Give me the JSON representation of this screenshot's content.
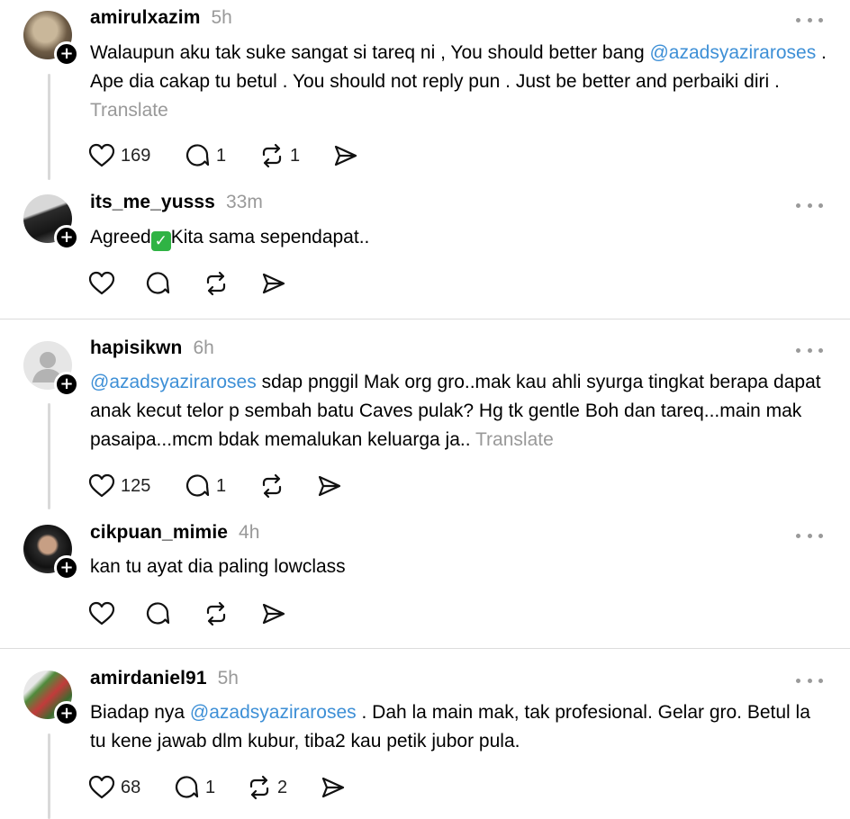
{
  "posts": [
    {
      "username": "amirulxazim",
      "time": "5h",
      "text_parts": [
        "Walaupun aku tak suke sangat si tareq ni , You should better bang ",
        "@azadsyaziraroses",
        " . Ape dia cakap tu betul . You should not reply pun . Just be better and perbaiki diri . ",
        "Translate"
      ],
      "likes": "169",
      "replies": "1",
      "reposts": "1"
    },
    {
      "username": "its_me_yusss",
      "time": "33m",
      "text_parts": [
        "Agreed",
        "✓",
        "Kita sama sependapat.."
      ],
      "likes": "",
      "replies": "",
      "reposts": ""
    },
    {
      "username": "hapisikwn",
      "time": "6h",
      "text_parts": [
        "@azadsyaziraroses",
        " sdap pnggil Mak org gro..mak kau ahli syurga tingkat berapa dapat anak kecut telor p sembah batu Caves pulak? Hg tk gentle Boh dan tareq...main mak pasaipa...mcm bdak memalukan keluarga ja.. ",
        "Translate"
      ],
      "likes": "125",
      "replies": "1",
      "reposts": ""
    },
    {
      "username": "cikpuan_mimie",
      "time": "4h",
      "text_parts": [
        "kan tu ayat dia paling lowclass"
      ],
      "likes": "",
      "replies": "",
      "reposts": ""
    },
    {
      "username": "amirdaniel91",
      "time": "5h",
      "text_parts": [
        "Biadap nya ",
        "@azadsyaziraroses",
        " . Dah la main mak, tak profesional. Gelar gro. Betul la tu kene jawab dlm kubur, tiba2 kau petik jubor pula."
      ],
      "likes": "68",
      "replies": "1",
      "reposts": "2"
    }
  ],
  "colors": {
    "mention": "#3d8fd6",
    "muted": "#999999",
    "divider": "#dcdcdc"
  }
}
